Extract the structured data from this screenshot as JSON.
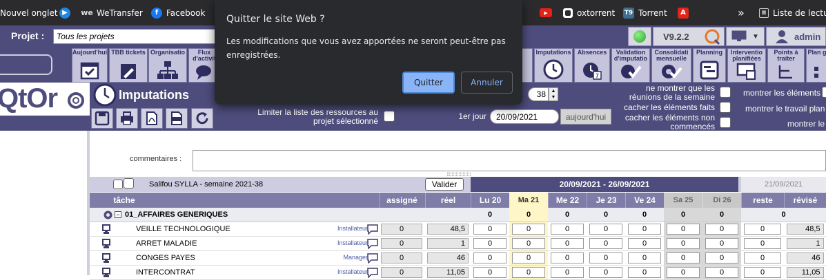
{
  "bookmarks": {
    "items": [
      {
        "label": "Nouvel onglet"
      },
      {
        "label": ""
      },
      {
        "label": "WeTransfer"
      },
      {
        "label": "Facebook"
      },
      {
        "label": ""
      },
      {
        "label": "oxtorrent"
      },
      {
        "label": "Torrent"
      },
      {
        "label": ""
      }
    ],
    "overflow": "»",
    "reading_list": "Liste de lectur"
  },
  "header": {
    "project_label": "Projet :",
    "project_value": "Tous les projets",
    "version": "V9.2.2",
    "user": "admin"
  },
  "modules": [
    {
      "label": "Aujourd'hui",
      "icon": "calendar-check-icon"
    },
    {
      "label": "TBB tickets",
      "icon": "edit-doc-icon"
    },
    {
      "label": "Organisatio",
      "icon": "org-chart-icon"
    },
    {
      "label": "Flux d'activit",
      "icon": "chat-icon"
    },
    {
      "label": "Imputations",
      "icon": "clock-icon"
    },
    {
      "label": "Absences",
      "icon": "calendar-clock-icon"
    },
    {
      "label": "Validation d'imputatio",
      "icon": "check-icon"
    },
    {
      "label": "Consolidati mensuelle",
      "icon": "gear-check-icon"
    },
    {
      "label": "Planning",
      "icon": "planning-icon"
    },
    {
      "label": "Interventio planifiées",
      "icon": "monitor-icon"
    },
    {
      "label": "Points à traiter",
      "icon": "tree-icon"
    },
    {
      "label": "Plan glo",
      "icon": "grid-icon"
    }
  ],
  "logo": {
    "text": "QtOr"
  },
  "imputations": {
    "title": "Imputations",
    "limit_label": "Limiter la liste des ressources au projet sélectionné",
    "first_day_label": "1er jour",
    "first_day_value": "20/09/2021",
    "today_button": "aujourd'hui",
    "spinner_value": "38",
    "options": [
      "ne montrer que les réunions de la semaine",
      "cacher les éléments faits",
      "cacher les éléments non commencés"
    ],
    "options_right": [
      "montrer les éléments",
      "montrer le travail plan",
      "montrer le"
    ],
    "comments_label": "commentaires :"
  },
  "week": {
    "resource": "Salifou SYLLA - semaine 2021-38",
    "validate_button": "Valider",
    "range": "20/09/2021 - 26/09/2021",
    "right_date": "21/09/2021",
    "columns": {
      "task": "tâche",
      "assigned": "assigné",
      "real": "réel",
      "days": [
        "Lu 20",
        "Ma 21",
        "Me 22",
        "Je 23",
        "Ve 24",
        "Sa 25",
        "Di 26"
      ],
      "remaining": "reste",
      "revised": "révisé"
    }
  },
  "group": {
    "name": "01_AFFAIRES GENERIQUES",
    "totals": [
      "0",
      "0",
      "0",
      "0",
      "0",
      "0",
      "0"
    ],
    "remaining_total": "0"
  },
  "rows": [
    {
      "task": "VEILLE TECHNOLOGIQUE",
      "role": "Installateur",
      "assigned": "0",
      "real": "48,5",
      "days": [
        "0",
        "0",
        "0",
        "0",
        "0",
        "0",
        "0"
      ],
      "remaining": "0",
      "revised": "48,5"
    },
    {
      "task": "ARRET MALADIE",
      "role": "Installateur",
      "assigned": "0",
      "real": "1",
      "days": [
        "0",
        "0",
        "0",
        "0",
        "0",
        "0",
        "0"
      ],
      "remaining": "0",
      "revised": "1"
    },
    {
      "task": "CONGES PAYES",
      "role": "Manager",
      "assigned": "0",
      "real": "46",
      "days": [
        "0",
        "0",
        "0",
        "0",
        "0",
        "0",
        "0"
      ],
      "remaining": "0",
      "revised": "46"
    },
    {
      "task": "INTERCONTRAT",
      "role": "Installateur",
      "assigned": "0",
      "real": "11,05",
      "days": [
        "0",
        "0",
        "0",
        "0",
        "0",
        "0",
        "0"
      ],
      "remaining": "0",
      "revised": "11,05"
    }
  ],
  "dialog": {
    "title": "Quitter le site Web ?",
    "message": "Les modifications que vous avez apportées ne seront peut-être pas enregistrées.",
    "quit_button": "Quitter",
    "cancel_button": "Annuler"
  },
  "colors": {
    "header_bg": "#4e4c7c",
    "today_col": "#fff6c8",
    "weekend_col": "#d8d8d8",
    "dialog_bg": "#292a2d",
    "dialog_primary": "#8ab4f8"
  }
}
